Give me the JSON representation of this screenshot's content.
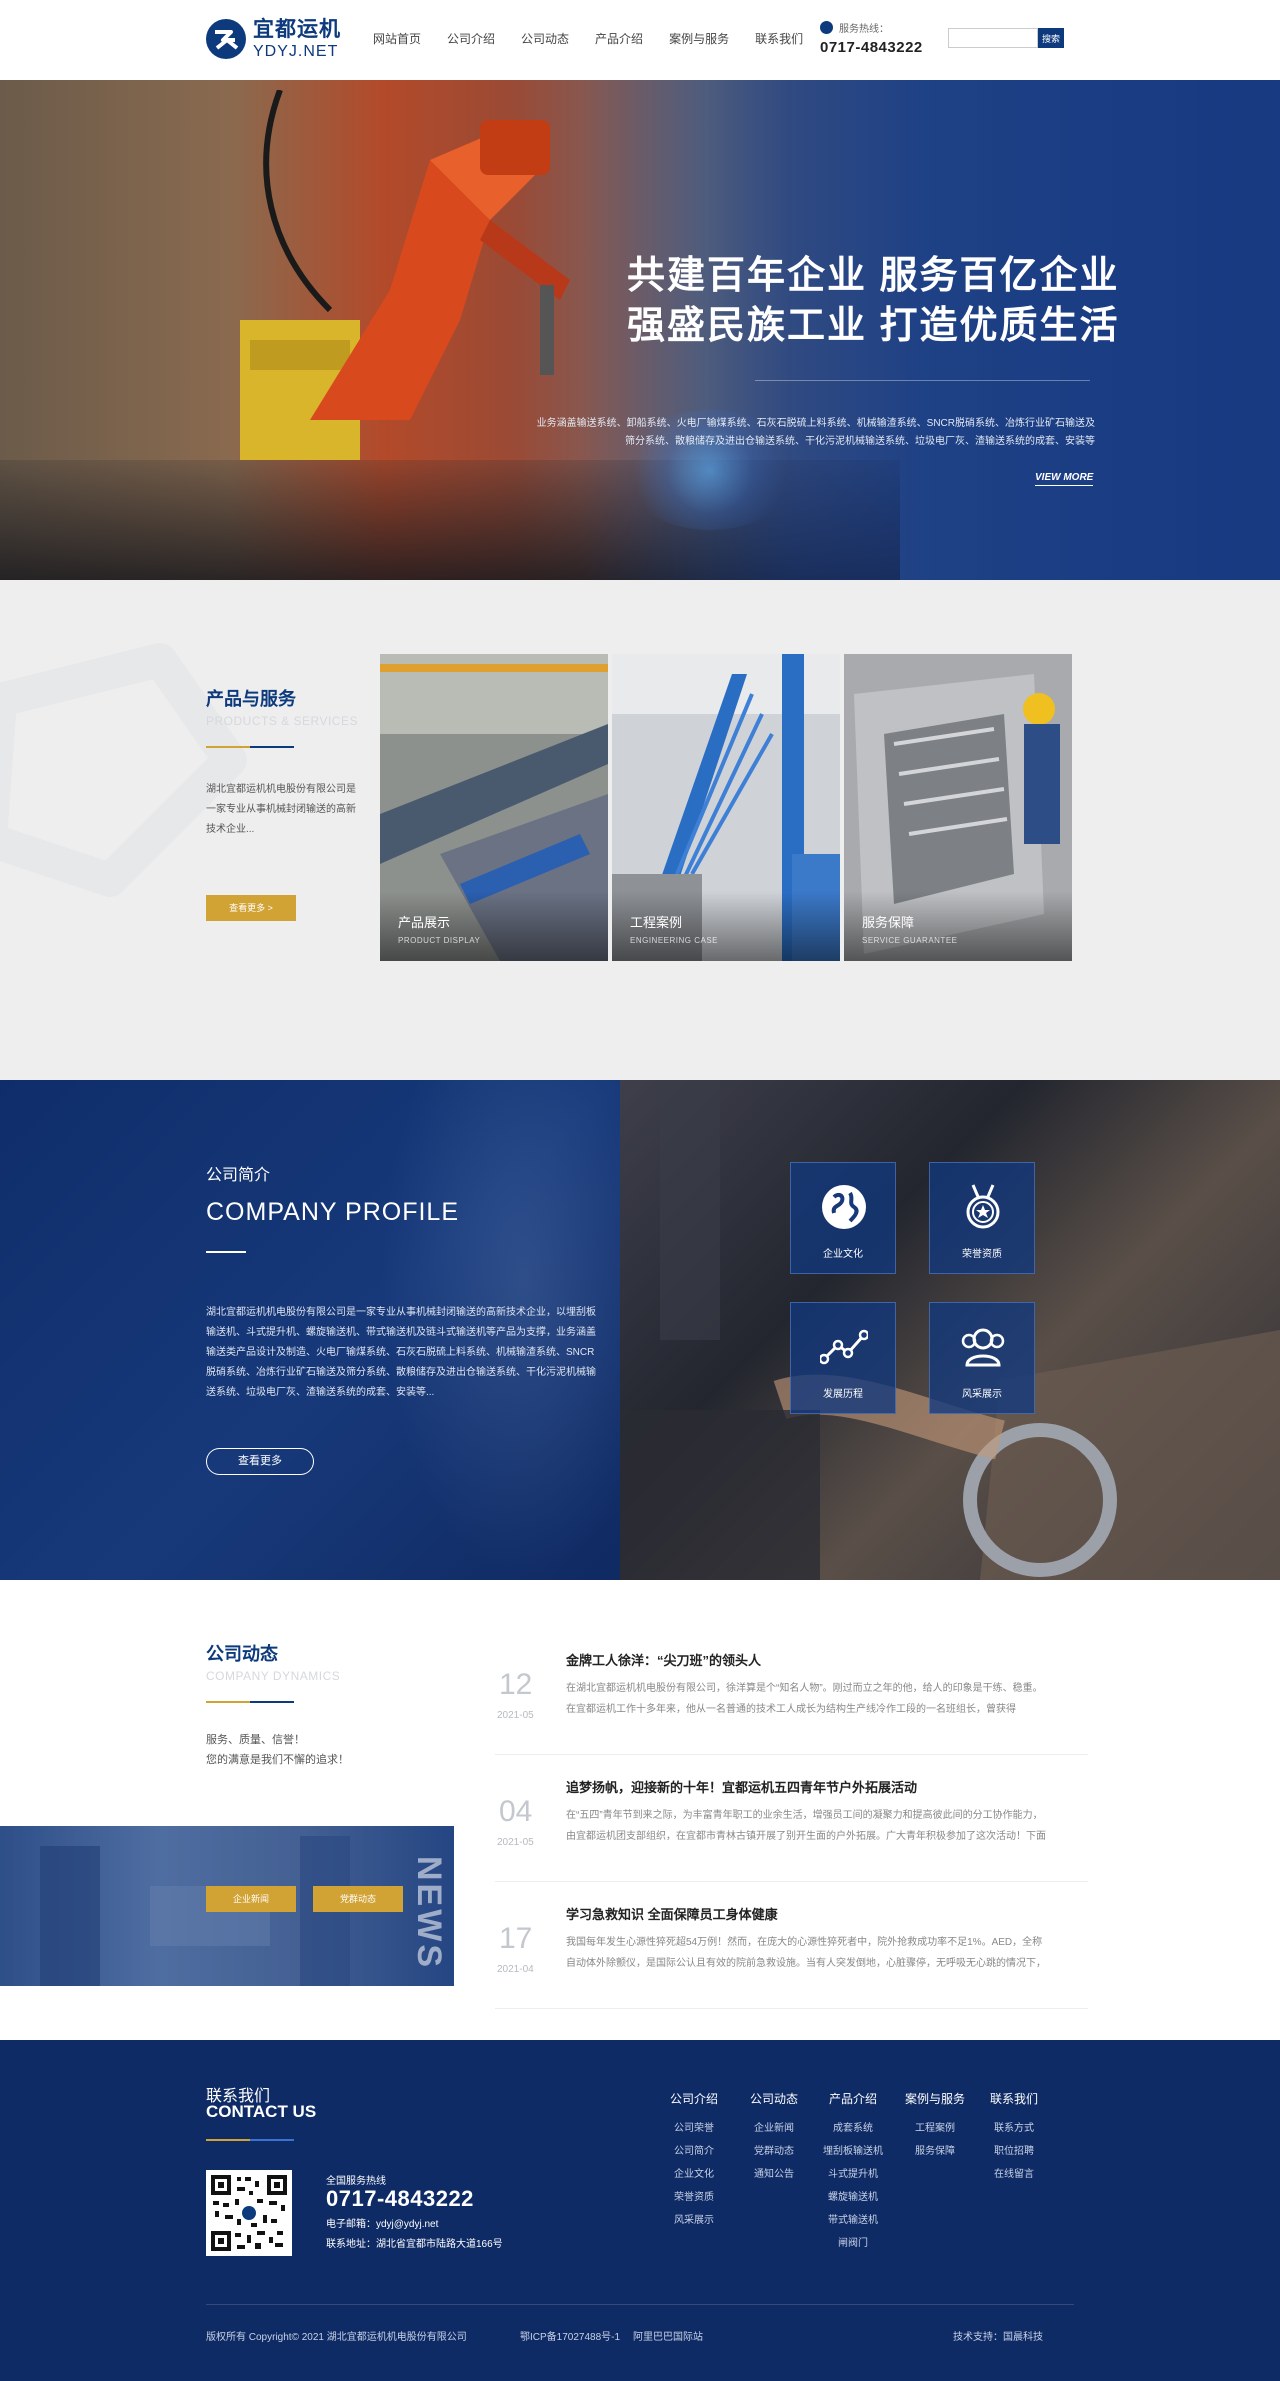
{
  "header": {
    "logo_cn": "宜都运机",
    "logo_en": "YDYJ.NET",
    "nav": [
      "网站首页",
      "公司介绍",
      "公司动态",
      "产品介绍",
      "案例与服务",
      "联系我们"
    ],
    "hotline_label": "服务热线：",
    "hotline": "0717-4843222",
    "search_placeholder": "",
    "search_button": "搜索"
  },
  "banner": {
    "headline_1": "共建百年企业  服务百亿企业",
    "headline_2": "强盛民族工业  打造优质生活",
    "description": "业务涵盖输送系统、卸船系统、火电厂输煤系统、石灰石脱硫上料系统、机械输渣系统、SNCR脱硝系统、冶炼行业矿石输送及筛分系统、散粮储存及进出仓输送系统、干化污泥机械输送系统、垃圾电厂灰、渣输送系统的成套、安装等",
    "more": "VIEW MORE",
    "slides": 3,
    "active_slide": 1
  },
  "products": {
    "title": "产品与服务",
    "subtitle": "PRODUCTS & SERVICES",
    "description": "湖北宜都运机机电股份有限公司是一家专业从事机械封闭输送的高新技术企业...",
    "more_button": "查看更多  >",
    "cards": [
      {
        "title": "产品展示",
        "subtitle": "PRODUCT DISPLAY"
      },
      {
        "title": "工程案例",
        "subtitle": "ENGINEERING CASE"
      },
      {
        "title": "服务保障",
        "subtitle": "SERVICE GUARANTEE"
      }
    ]
  },
  "profile": {
    "title": "公司简介",
    "title_en": "COMPANY PROFILE",
    "description": "湖北宜都运机机电股份有限公司是一家专业从事机械封闭输送的高新技术企业，以埋刮板输送机、斗式提升机、螺旋输送机、带式输送机及链斗式输送机等产品为支撑，业务涵盖输送类产品设计及制造、火电厂输煤系统、石灰石脱硫上料系统、机械输渣系统、SNCR脱硝系统、冶炼行业矿石输送及筛分系统、散粮储存及进出仓输送系统、干化污泥机械输送系统、垃圾电厂灰、渣输送系统的成套、安装等...",
    "button": "查看更多",
    "tiles": [
      {
        "label": "企业文化",
        "icon": "globe-icon"
      },
      {
        "label": "荣誉资质",
        "icon": "medal-icon"
      },
      {
        "label": "发展历程",
        "icon": "chart-line-icon"
      },
      {
        "label": "风采展示",
        "icon": "people-icon"
      }
    ]
  },
  "news": {
    "title": "公司动态",
    "subtitle": "COMPANY DYNAMICS",
    "slogan_1": "服务、质量、信誉！",
    "slogan_2": "您的满意是我们不懈的追求！",
    "btn_company": "企业新闻",
    "btn_party": "党群动态",
    "vertical_text": "NEWS",
    "items": [
      {
        "day": "12",
        "date": "2021-05",
        "title": "金牌工人徐洋：“尖刀班”的领头人",
        "text": "在湖北宜都运机机电股份有限公司，徐洋算是个“知名人物”。刚过而立之年的他，给人的印象是干练、稳重。在宜都运机工作十多年来，他从一名普通的技术工人成长为结构生产线冷作工段的一名班组长，曾获得"
      },
      {
        "day": "04",
        "date": "2021-05",
        "title": "追梦扬帆，迎接新的十年！宜都运机五四青年节户外拓展活动",
        "text": "在“五四”青年节到来之际，为丰富青年职工的业余生活，增强员工间的凝聚力和提高彼此间的分工协作能力，由宜都运机团支部组织，在宜都市青林古镇开展了别开生面的户外拓展。广大青年积极参加了这次活动！下面"
      },
      {
        "day": "17",
        "date": "2021-04",
        "title": "学习急救知识 全面保障员工身体健康",
        "text": "我国每年发生心源性猝死超54万例！然而，在庞大的心源性猝死者中，院外抢救成功率不足1%。AED，全称自动体外除颤仪，是国际公认且有效的院前急救设施。当有人突发倒地，心脏骤停，无呼吸无心跳的情况下，"
      }
    ]
  },
  "footer": {
    "contact_cn": "联系我们",
    "contact_en": "CONTACT US",
    "hotline_label": "全国服务热线",
    "hotline": "0717-4843222",
    "email": "电子邮箱：ydyj@ydyj.net",
    "address": "联系地址：湖北省宜都市陆路大道166号",
    "columns": [
      {
        "title": "公司介绍",
        "items": [
          "公司荣誉",
          "公司简介",
          "企业文化",
          "荣誉资质",
          "风采展示"
        ]
      },
      {
        "title": "公司动态",
        "items": [
          "企业新闻",
          "党群动态",
          "通知公告"
        ]
      },
      {
        "title": "产品介绍",
        "items": [
          "成套系统",
          "埋刮板输送机",
          "斗式提升机",
          "螺旋输送机",
          "带式输送机",
          "闸阀门"
        ]
      },
      {
        "title": "案例与服务",
        "items": [
          "工程案例",
          "服务保障"
        ]
      },
      {
        "title": "联系我们",
        "items": [
          "联系方式",
          "职位招聘",
          "在线留言"
        ]
      }
    ],
    "copyright": "版权所有 Copyright© 2021  湖北宜都运机机电股份有限公司",
    "icp": "鄂ICP备17027488号-1",
    "alibaba": "阿里巴巴国际站",
    "tech": "技术支持：国晨科技"
  },
  "colors": {
    "brand_blue": "#0d3a7d",
    "gold": "#d1a234",
    "footer_bg": "#0f2b66"
  }
}
